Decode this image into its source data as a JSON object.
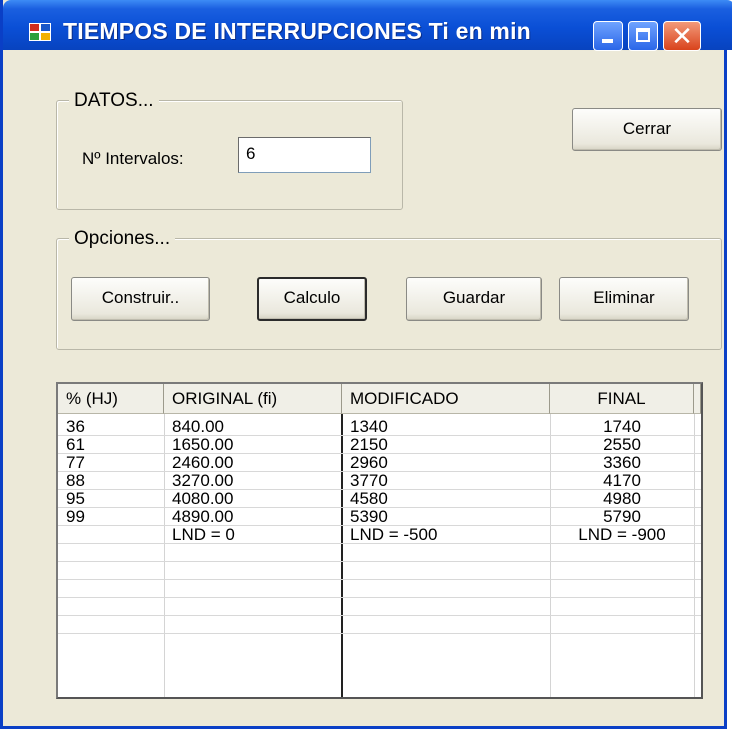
{
  "window": {
    "title": "TIEMPOS DE INTERRUPCIONES Ti en min"
  },
  "datos": {
    "legend": "DATOS...",
    "intervalos_label": "Nº Intervalos:",
    "intervalos_value": "6"
  },
  "buttons": {
    "cerrar": "Cerrar"
  },
  "opciones": {
    "legend": "Opciones...",
    "construir": "Construir..",
    "calculo": "Calculo",
    "guardar": "Guardar",
    "eliminar": "Eliminar"
  },
  "table": {
    "headers": [
      "% (HJ)",
      "ORIGINAL (fi)",
      "MODIFICADO",
      "FINAL"
    ],
    "rows": [
      [
        "36",
        "840.00",
        "1340",
        "1740"
      ],
      [
        "61",
        "1650.00",
        "2150",
        "2550"
      ],
      [
        "77",
        "2460.00",
        "2960",
        "3360"
      ],
      [
        "88",
        "3270.00",
        "3770",
        "4170"
      ],
      [
        "95",
        "4080.00",
        "4580",
        "4980"
      ],
      [
        "99",
        "4890.00",
        "5390",
        "5790"
      ],
      [
        "",
        "LND = 0",
        "LND = -500",
        "LND = -900"
      ],
      [
        "",
        "",
        "",
        ""
      ],
      [
        "",
        "",
        "",
        ""
      ],
      [
        "",
        "",
        "",
        ""
      ],
      [
        "",
        "",
        "",
        ""
      ],
      [
        "",
        "",
        "",
        ""
      ]
    ]
  },
  "icons": {
    "app": "windows-app-icon",
    "minimize": "minimize-icon",
    "maximize": "maximize-icon",
    "close": "close-icon"
  },
  "colors": {
    "titlebar": "#0a4fd6",
    "window_bg": "#ece9d8",
    "close_button": "#d9431c"
  }
}
